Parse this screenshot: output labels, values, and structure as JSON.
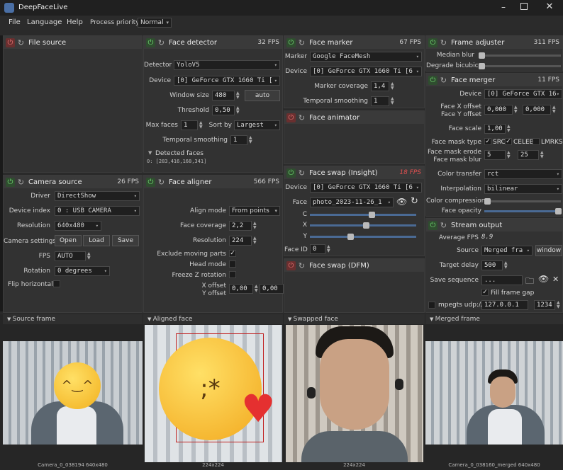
{
  "app": {
    "title": "DeepFaceLive"
  },
  "menu": {
    "file": "File",
    "language": "Language",
    "help": "Help",
    "priority_label": "Process priority",
    "priority_value": "Normal"
  },
  "file_source": {
    "title": "File source"
  },
  "camera_source": {
    "title": "Camera source",
    "fps": "26 FPS",
    "driver_label": "Driver",
    "driver": "DirectShow",
    "device_index_label": "Device index",
    "device_index": "0 : USB CAMERA",
    "resolution_label": "Resolution",
    "resolution": "640x480",
    "camera_settings_label": "Camera settings",
    "open": "Open",
    "load": "Load",
    "save": "Save",
    "fps_label": "FPS",
    "fps_value": "AUTO",
    "rotation_label": "Rotation",
    "rotation": "0 degrees",
    "flip_label": "Flip horizontal"
  },
  "face_detector": {
    "title": "Face detector",
    "fps": "32 FPS",
    "detector_label": "Detector",
    "detector": "YoloV5",
    "device_label": "Device",
    "device": "[0] GeForce GTX 1660 Ti [",
    "window_size_label": "Window size",
    "window_size": "480",
    "auto": "auto",
    "threshold_label": "Threshold",
    "threshold": "0,50",
    "max_faces_label": "Max faces",
    "max_faces": "1",
    "sort_by_label": "Sort by",
    "sort_by": "Largest",
    "temporal_label": "Temporal smoothing",
    "temporal": "1",
    "detected_label": "Detected faces",
    "detected_value": "0: [283,416,168,341]"
  },
  "face_aligner": {
    "title": "Face aligner",
    "fps": "566 FPS",
    "align_mode_label": "Align mode",
    "align_mode": "From points",
    "coverage_label": "Face coverage",
    "coverage": "2,2",
    "resolution_label": "Resolution",
    "resolution": "224",
    "exclude_label": "Exclude moving parts",
    "head_mode_label": "Head mode",
    "freeze_label": "Freeze Z rotation",
    "xoff_label": "X offset",
    "yoff_label": "Y offset",
    "xoff": "0,00",
    "yoff": "0,00"
  },
  "face_marker": {
    "title": "Face marker",
    "fps": "67 FPS",
    "marker_label": "Marker",
    "marker": "Google FaceMesh",
    "device_label": "Device",
    "device": "[0] GeForce GTX 1660 Ti [6",
    "coverage_label": "Marker coverage",
    "coverage": "1,4",
    "temporal_label": "Temporal smoothing",
    "temporal": "1"
  },
  "face_animator": {
    "title": "Face animator"
  },
  "face_swap_insight": {
    "title": "Face swap (Insight)",
    "fps": "18 FPS",
    "device_label": "Device",
    "device": "[0] GeForce GTX 1660 Ti [6",
    "face_label": "Face",
    "face": "photo_2023-11-26_1",
    "c_label": "C",
    "x_label": "X",
    "y_label": "Y",
    "faceid_label": "Face ID",
    "faceid": "0"
  },
  "face_swap_dfm": {
    "title": "Face swap (DFM)"
  },
  "frame_adjuster": {
    "title": "Frame adjuster",
    "fps": "311 FPS",
    "median_label": "Median blur",
    "degrade_label": "Degrade bicubic"
  },
  "face_merger": {
    "title": "Face merger",
    "fps": "11 FPS",
    "device_label": "Device",
    "device": "[0] GeForce GTX 16",
    "xoff_label": "Face X offset",
    "yoff_label": "Face Y offset",
    "xoff": "0,000",
    "yoff": "0,000",
    "scale_label": "Face scale",
    "scale": "1,00",
    "mask_type_label": "Face mask type",
    "src": "SRC",
    "celeb": "CELEB",
    "lmrks": "LMRKS",
    "erode_label": "Face mask erode",
    "blur_label": "Face mask blur",
    "erode": "5",
    "blur": "25",
    "color_transfer_label": "Color transfer",
    "color_transfer": "rct",
    "interp_label": "Interpolation",
    "interp": "bilinear",
    "compression_label": "Color compression",
    "opacity_label": "Face opacity"
  },
  "stream_output": {
    "title": "Stream output",
    "avg_fps_label": "Average FPS",
    "avg_fps": "8.9",
    "source_label": "Source",
    "source": "Merged fra",
    "window": "window",
    "delay_label": "Target delay",
    "delay": "500",
    "save_seq_label": "Save sequence",
    "save_seq": "...",
    "fill_gap": "Fill frame gap",
    "mpegts_label": "mpegts udp://",
    "ip": "127.0.0.1",
    "port": "1234"
  },
  "views": {
    "source": "Source frame",
    "aligned": "Aligned face",
    "swapped": "Swapped face",
    "merged": "Merged frame",
    "source_caption": "Camera_0_038194 640x480",
    "aligned_caption": "224x224",
    "swapped_caption": "224x224",
    "merged_caption": "Camera_0_038160_merged 640x480"
  },
  "colors": {
    "power_on": "#6fd36f",
    "power_off": "#e07070",
    "fps_warn": "#e05050"
  }
}
